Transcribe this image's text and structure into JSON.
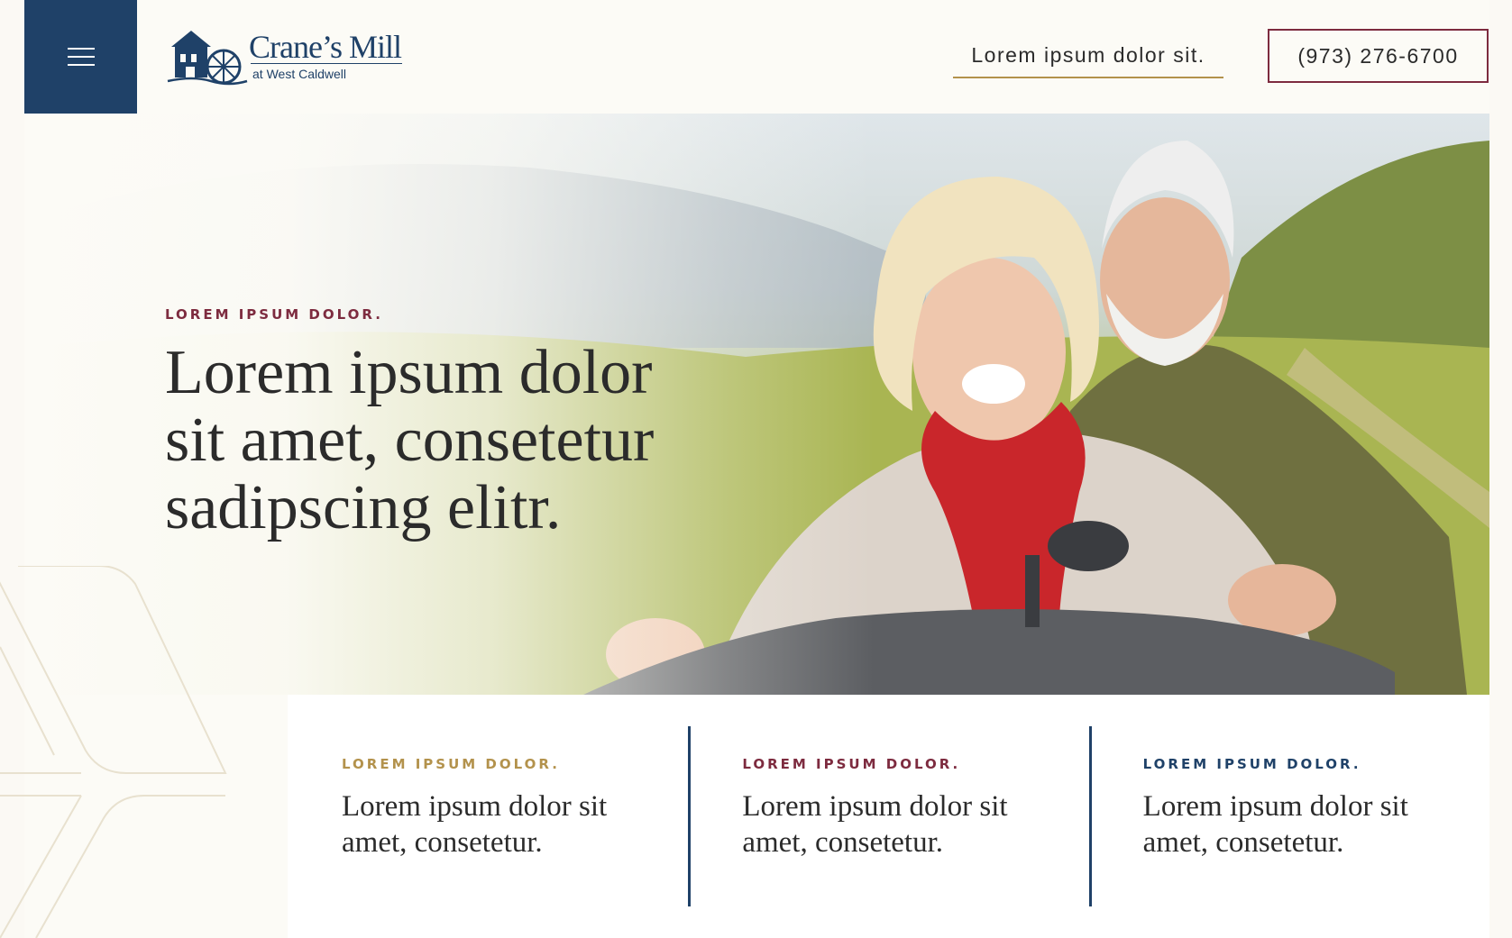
{
  "header": {
    "menu_icon": "hamburger-menu-icon",
    "logo": {
      "name": "Crane’s Mill",
      "subtitle": "at West Caldwell",
      "icon": "mill-logo-icon"
    },
    "top_link": "Lorem ipsum dolor sit.",
    "phone": "(973) 276-6700"
  },
  "hero": {
    "eyebrow": "LOREM IPSUM DOLOR.",
    "title": "Lorem ipsum dolor sit amet, consetetur sadipscing elitr.",
    "image": "smiling-senior-couple-riding-bike-photo"
  },
  "cards": [
    {
      "eyebrow": "LOREM IPSUM DOLOR.",
      "text": "Lorem ipsum dolor sit amet, consetetur.",
      "accent": "#b3924c"
    },
    {
      "eyebrow": "LOREM IPSUM DOLOR.",
      "text": "Lorem ipsum dolor sit amet, consetetur.",
      "accent": "#7d2b3f"
    },
    {
      "eyebrow": "LOREM IPSUM DOLOR.",
      "text": "Lorem ipsum dolor sit amet, consetetur.",
      "accent": "#1f4168"
    }
  ],
  "colors": {
    "navy": "#1f4168",
    "gold": "#b3924c",
    "burgundy": "#7d2b3f",
    "background": "#fcfbf6",
    "text": "#2b2b2b"
  }
}
